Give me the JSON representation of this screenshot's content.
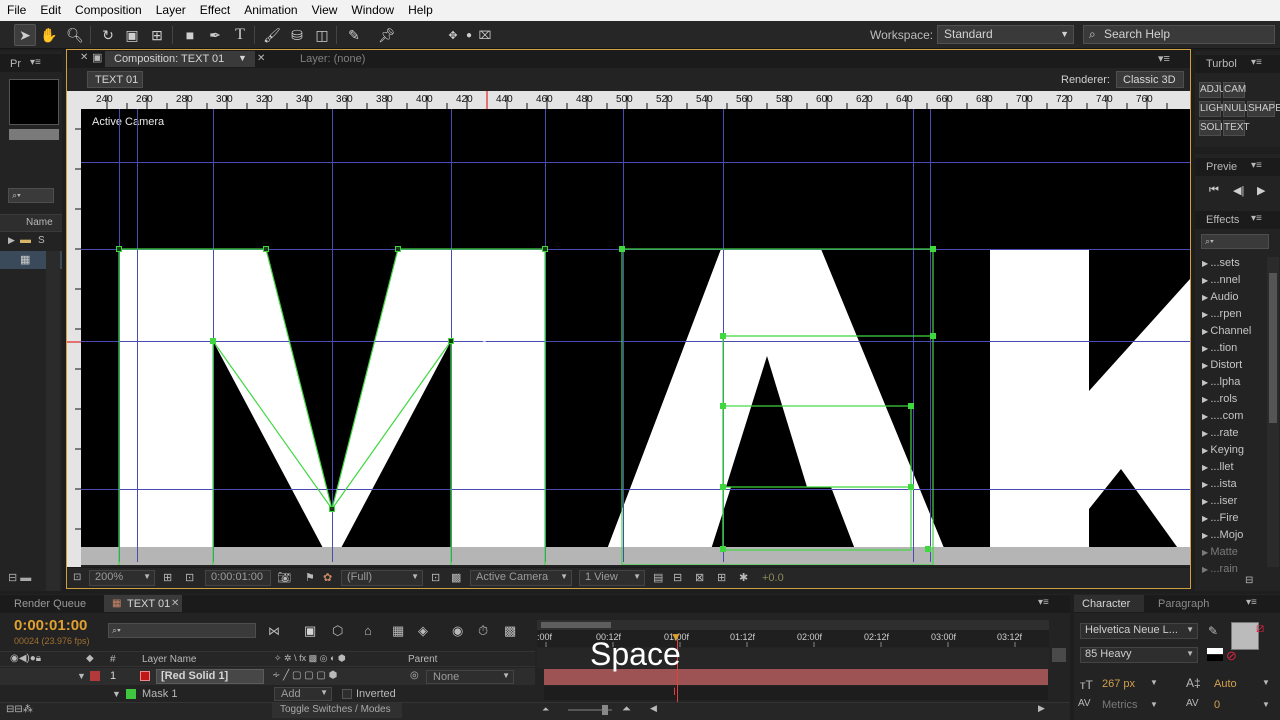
{
  "menu": [
    "File",
    "Edit",
    "Composition",
    "Layer",
    "Effect",
    "Animation",
    "View",
    "Window",
    "Help"
  ],
  "workspace": {
    "label": "Workspace:",
    "value": "Standard"
  },
  "search_help": "Search Help",
  "left_panel": {
    "tab": "Pr",
    "column_name": "Name",
    "folder_label": "S"
  },
  "composition_panel": {
    "tab_label": "Composition: TEXT 01",
    "layer_tab": "Layer: (none)",
    "sub_tab": "TEXT 01",
    "renderer_label": "Renderer:",
    "renderer_value": "Classic 3D",
    "view_label": "Active Camera",
    "ruler_ticks": [
      "240",
      "260",
      "280",
      "300",
      "320",
      "340",
      "360",
      "380",
      "400",
      "420",
      "440",
      "460",
      "480",
      "500",
      "520",
      "540",
      "560",
      "580",
      "600",
      "620",
      "640",
      "660",
      "680",
      "700",
      "720",
      "740",
      "760"
    ],
    "footer": {
      "zoom": "200%",
      "timecode": "0:00:01:00",
      "resolution": "(Full)",
      "camera": "Active Camera",
      "views": "1 View",
      "exposure": "+0.0"
    }
  },
  "right_panels": {
    "turbol": {
      "title": "Turbol",
      "buttons": [
        "ADJU",
        "CAM",
        "LIGHT",
        "NULL",
        "SHAPE",
        "SOLID",
        "TEXT"
      ]
    },
    "preview": {
      "title": "Previe"
    },
    "effects": {
      "title": "Effects",
      "items": [
        "...sets",
        "...nnel",
        "Audio",
        "...rpen",
        "Channel",
        "...tion",
        "Distort",
        "...lpha",
        "...rols",
        "....com",
        "...rate",
        "Keying",
        "...llet",
        "...ista",
        "...iser",
        "...Fire",
        "...Mojo",
        "Matte",
        "...rain"
      ]
    }
  },
  "timeline": {
    "render_queue_tab": "Render Queue",
    "comp_tab": "TEXT 01",
    "timecode": "0:00:01:00",
    "frame_info": "00024 (23.976 fps)",
    "columns": {
      "layer_name": "Layer Name",
      "parent": "Parent",
      "hash": "#"
    },
    "time_ticks": [
      ":00f",
      "00:12f",
      "01:00f",
      "01:12f",
      "02:00f",
      "02:12f",
      "03:00f",
      "03:12f"
    ],
    "layers": [
      {
        "number": "1",
        "name": "[Red Solid 1]",
        "parent": "None"
      }
    ],
    "mask": {
      "name": "Mask 1",
      "mode": "Add",
      "inverted_label": "Inverted"
    },
    "toggle_label": "Toggle Switches / Modes",
    "overlay_key": "Space"
  },
  "character_panel": {
    "tab": "Character",
    "paragraph_tab": "Paragraph",
    "font": "Helvetica Neue L...",
    "style": "85 Heavy",
    "size": "267 px",
    "leading": "Auto",
    "kerning": "Metrics",
    "tracking": "0"
  },
  "colors": {
    "accent_green": "#3fd83f",
    "guide_blue": "#4a4ab5",
    "timecode_orange": "#e0a030",
    "layer_bar": "#b35c5c"
  }
}
